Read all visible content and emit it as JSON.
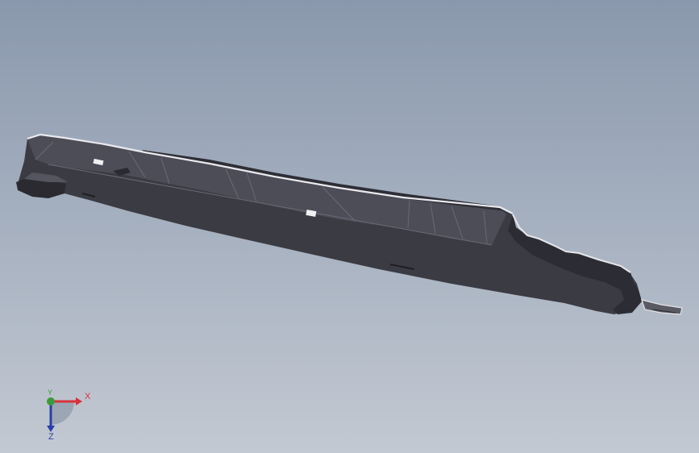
{
  "viewport": {
    "background_top": "#8a98ad",
    "background_bottom": "#c3c9d2"
  },
  "model": {
    "name_icon": "part-icon",
    "body_color": "#3c3c44",
    "top_face_color": "#50505a",
    "edge_color": "#e8e8ec"
  },
  "triad": {
    "x_label": "X",
    "y_label": "Y",
    "z_label": "Z",
    "x_color": "#d8313a",
    "y_color": "#3c9a3c",
    "z_color": "#2b3fa8"
  }
}
